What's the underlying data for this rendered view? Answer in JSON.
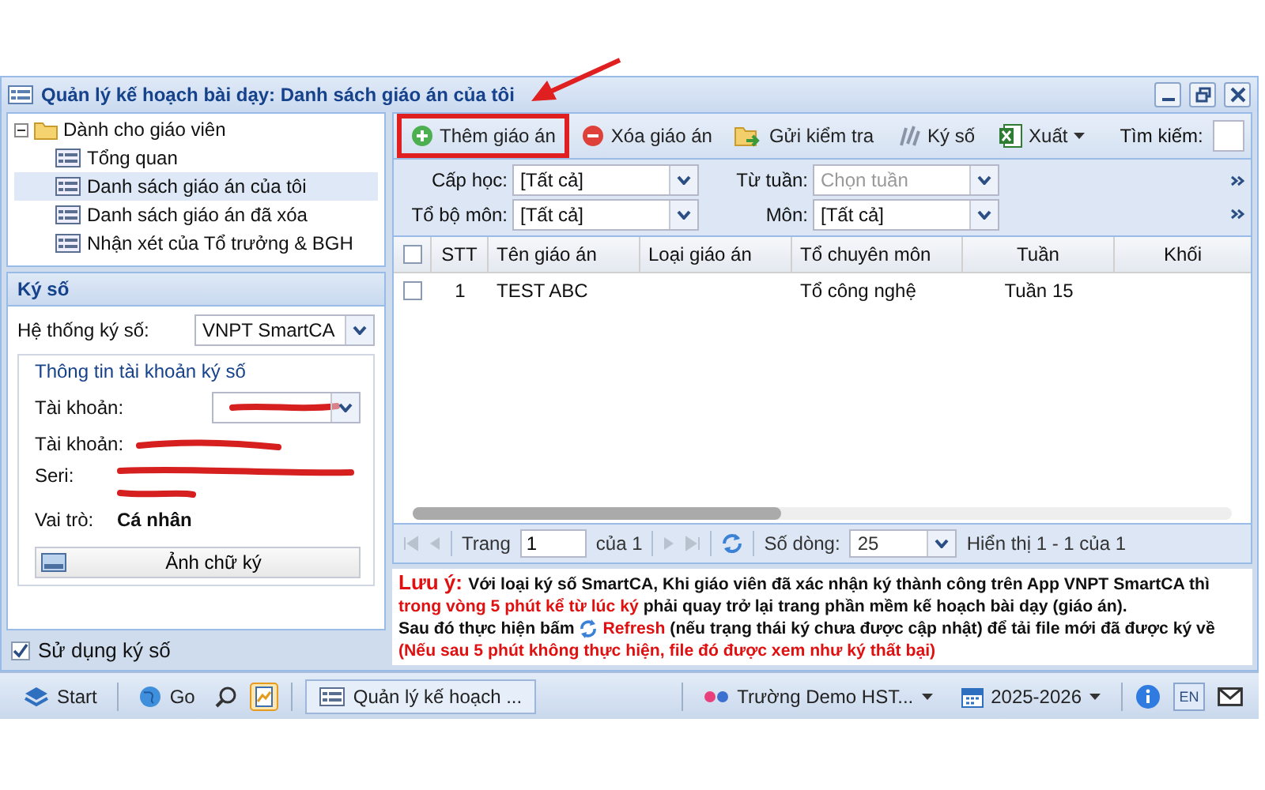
{
  "window": {
    "title": "Quản lý kế hoạch bài dạy: Danh sách giáo án của tôi"
  },
  "tree": [
    {
      "label": "Dành cho giáo viên",
      "expanded": true,
      "children": [
        {
          "label": "Tổng quan",
          "selected": false
        },
        {
          "label": "Danh sách giáo án của tôi",
          "selected": true
        },
        {
          "label": "Danh sách giáo án đã xóa",
          "selected": false
        },
        {
          "label": "Nhận xét của Tổ trưởng & BGH",
          "selected": false
        }
      ]
    }
  ],
  "sign_panel": {
    "title": "Ký số",
    "system_label": "Hệ thống ký số:",
    "system_value": "VNPT SmartCA",
    "group_title": "Thông tin tài khoản ký số",
    "account_select_label": "Tài khoản:",
    "account_label": "Tài khoản:",
    "serial_label": "Seri:",
    "role_label": "Vai trò:",
    "role_value": "Cá nhân",
    "signature_button": "Ảnh chữ ký",
    "use_signing": {
      "label": "Sử dụng ký số",
      "checked": true
    }
  },
  "toolbar": {
    "buttons": [
      {
        "kind": "add",
        "label": "Thêm giáo án",
        "highlighted": true
      },
      {
        "kind": "delete",
        "label": "Xóa giáo án",
        "highlighted": false
      },
      {
        "kind": "send",
        "label": "Gửi kiểm tra",
        "highlighted": false
      },
      {
        "kind": "sign",
        "label": "Ký số",
        "highlighted": false
      },
      {
        "kind": "export",
        "label": "Xuất",
        "highlighted": false
      }
    ],
    "search_label": "Tìm kiếm:"
  },
  "filters": [
    {
      "label": "Cấp học:",
      "value": "[Tất cả]"
    },
    {
      "label": "Từ tuần:",
      "placeholder": "Chọn tuần"
    },
    {
      "label": "Tổ bộ môn:",
      "value": "[Tất cả]"
    },
    {
      "label": "Môn:",
      "value": "[Tất cả]"
    }
  ],
  "table": {
    "all_checked": false,
    "columns": [
      "STT",
      "Tên giáo án",
      "Loại giáo án",
      "Tổ chuyên môn",
      "Tuần",
      "Khối"
    ],
    "rows": [
      {
        "checked": false,
        "stt": "1",
        "name": "TEST ABC",
        "group": "Tổ công nghệ",
        "week": "Tuần 15"
      }
    ]
  },
  "pager": {
    "page_label": "Trang",
    "page": "1",
    "of_label": "của 1",
    "rows_label": "Số dòng:",
    "rows": "25",
    "summary": "Hiển thị 1 - 1 của 1"
  },
  "note": {
    "lines": [
      [
        {
          "text": "Lưu ý: ",
          "kind": "title"
        },
        {
          "text": "Với loại ký số SmartCA, Khi giáo viên đã xác nhận ký thành công trên App VNPT SmartCA thì ",
          "kind": "plain"
        },
        {
          "text": "trong vòng 5 phút kể từ lúc ký",
          "kind": "red"
        },
        {
          "text": " phải quay trở lại trang phần mềm kế hoạch bài dạy (giáo án).",
          "kind": "plain"
        }
      ]
    ],
    "refresh_before": "Sau đó thực hiện bấm",
    "refresh_line": [
      {
        "text": "Refresh",
        "kind": "red"
      },
      {
        "text": " (nếu trạng thái ký chưa được cập nhật) để tải file mới đã được ký về",
        "kind": "plain"
      }
    ],
    "warning": "(Nếu sau 5 phút không thực hiện, file đó được xem như ký thất bại)"
  },
  "taskbar": {
    "start": "Start",
    "go": "Go",
    "task": "Quản lý kế hoạch ...",
    "school": "Trường Demo HST...",
    "year": "2025-2026",
    "language": "EN"
  }
}
